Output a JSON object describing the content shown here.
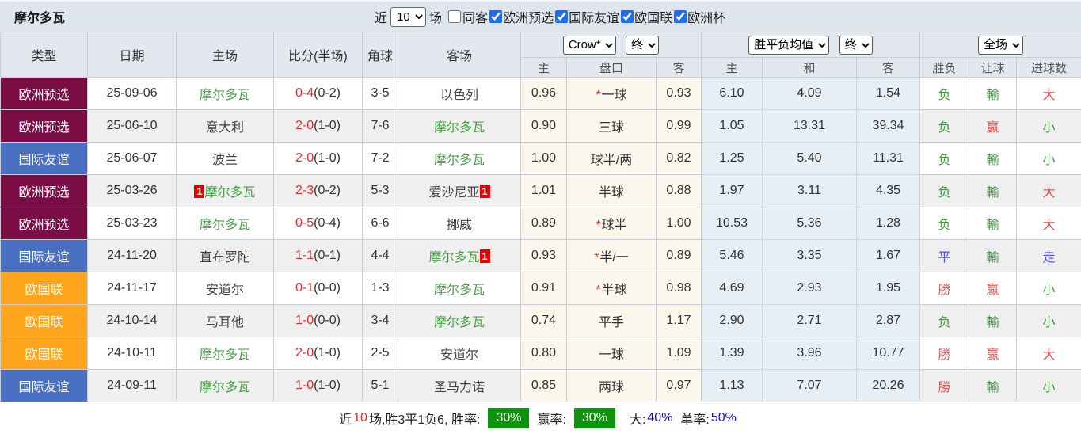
{
  "title": "摩尔多瓦",
  "toolbar": {
    "near_label": "近",
    "matches_selected": "10",
    "chang_label": "场",
    "tongke_label": "同客",
    "filters": [
      {
        "label": "欧洲预选",
        "checked": true
      },
      {
        "label": "国际友谊",
        "checked": true
      },
      {
        "label": "欧国联",
        "checked": true
      },
      {
        "label": "欧洲杯",
        "checked": true
      }
    ]
  },
  "table": {
    "col_headers": [
      "类型",
      "日期",
      "主场",
      "比分(半场)",
      "角球",
      "客场"
    ],
    "selects": {
      "company": "Crow*",
      "final1": "终",
      "avg": "胜平负均值",
      "final2": "终",
      "period": "全场"
    },
    "subheaders": [
      "主",
      "盘口",
      "客",
      "主",
      "和",
      "客",
      "胜负",
      "让球",
      "进球数"
    ],
    "rows": [
      {
        "type": "欧洲预选",
        "type_color": "maroon",
        "date": "25-09-06",
        "home": {
          "name": "摩尔多瓦",
          "green": true,
          "card": false
        },
        "score_full": "0-4",
        "score_half": "(0-2)",
        "corners": "3-5",
        "away": {
          "name": "以色列",
          "green": false,
          "card": false
        },
        "odds": {
          "home": "0.96",
          "line": "一球",
          "line_star": true,
          "away": "0.93"
        },
        "avg": {
          "win": "6.10",
          "draw": "4.09",
          "lose": "1.54"
        },
        "result": {
          "wl": {
            "text": "负",
            "color": "green"
          },
          "handicap": {
            "text": "輸",
            "color": "green"
          },
          "goals": {
            "text": "大",
            "color": "red"
          }
        }
      },
      {
        "type": "欧洲预选",
        "type_color": "maroon",
        "date": "25-06-10",
        "home": {
          "name": "意大利",
          "green": false,
          "card": false
        },
        "score_full": "2-0",
        "score_half": "(1-0)",
        "corners": "7-6",
        "away": {
          "name": "摩尔多瓦",
          "green": true,
          "card": false
        },
        "odds": {
          "home": "0.90",
          "line": "三球",
          "line_star": false,
          "away": "0.99"
        },
        "avg": {
          "win": "1.05",
          "draw": "13.31",
          "lose": "39.34"
        },
        "result": {
          "wl": {
            "text": "负",
            "color": "green"
          },
          "handicap": {
            "text": "赢",
            "color": "red"
          },
          "goals": {
            "text": "小",
            "color": "green"
          }
        }
      },
      {
        "type": "国际友谊",
        "type_color": "blue",
        "date": "25-06-07",
        "home": {
          "name": "波兰",
          "green": false,
          "card": false
        },
        "score_full": "2-0",
        "score_half": "(1-0)",
        "corners": "7-2",
        "away": {
          "name": "摩尔多瓦",
          "green": true,
          "card": false
        },
        "odds": {
          "home": "1.00",
          "line": "球半/两",
          "line_star": false,
          "away": "0.82"
        },
        "avg": {
          "win": "1.25",
          "draw": "5.40",
          "lose": "11.31"
        },
        "result": {
          "wl": {
            "text": "负",
            "color": "green"
          },
          "handicap": {
            "text": "輸",
            "color": "green"
          },
          "goals": {
            "text": "小",
            "color": "green"
          }
        }
      },
      {
        "type": "欧洲预选",
        "type_color": "maroon",
        "date": "25-03-26",
        "home": {
          "name": "摩尔多瓦",
          "green": true,
          "card": true
        },
        "score_full": "2-3",
        "score_half": "(0-2)",
        "corners": "5-3",
        "away": {
          "name": "爱沙尼亚",
          "green": false,
          "card": true
        },
        "odds": {
          "home": "1.01",
          "line": "半球",
          "line_star": false,
          "away": "0.88"
        },
        "avg": {
          "win": "1.97",
          "draw": "3.11",
          "lose": "4.35"
        },
        "result": {
          "wl": {
            "text": "负",
            "color": "green"
          },
          "handicap": {
            "text": "輸",
            "color": "green"
          },
          "goals": {
            "text": "大",
            "color": "red"
          }
        }
      },
      {
        "type": "欧洲预选",
        "type_color": "maroon",
        "date": "25-03-23",
        "home": {
          "name": "摩尔多瓦",
          "green": true,
          "card": false
        },
        "score_full": "0-5",
        "score_half": "(0-4)",
        "corners": "6-6",
        "away": {
          "name": "挪威",
          "green": false,
          "card": false
        },
        "odds": {
          "home": "0.89",
          "line": "球半",
          "line_star": true,
          "away": "1.00"
        },
        "avg": {
          "win": "10.53",
          "draw": "5.36",
          "lose": "1.28"
        },
        "result": {
          "wl": {
            "text": "负",
            "color": "green"
          },
          "handicap": {
            "text": "輸",
            "color": "green"
          },
          "goals": {
            "text": "大",
            "color": "red"
          }
        }
      },
      {
        "type": "国际友谊",
        "type_color": "blue",
        "date": "24-11-20",
        "home": {
          "name": "直布罗陀",
          "green": false,
          "card": false
        },
        "score_full": "1-1",
        "score_half": "(0-1)",
        "corners": "4-4",
        "away": {
          "name": "摩尔多瓦",
          "green": true,
          "card": true
        },
        "odds": {
          "home": "0.93",
          "line": "半/一",
          "line_star": true,
          "away": "0.89"
        },
        "avg": {
          "win": "5.46",
          "draw": "3.35",
          "lose": "1.67"
        },
        "result": {
          "wl": {
            "text": "平",
            "color": "blue"
          },
          "handicap": {
            "text": "輸",
            "color": "green"
          },
          "goals": {
            "text": "走",
            "color": "blue"
          }
        }
      },
      {
        "type": "欧国联",
        "type_color": "orange",
        "date": "24-11-17",
        "home": {
          "name": "安道尔",
          "green": false,
          "card": false
        },
        "score_full": "0-1",
        "score_half": "(0-0)",
        "corners": "1-3",
        "away": {
          "name": "摩尔多瓦",
          "green": true,
          "card": false
        },
        "odds": {
          "home": "0.91",
          "line": "半球",
          "line_star": true,
          "away": "0.98"
        },
        "avg": {
          "win": "4.69",
          "draw": "2.93",
          "lose": "1.95"
        },
        "result": {
          "wl": {
            "text": "勝",
            "color": "red"
          },
          "handicap": {
            "text": "赢",
            "color": "red"
          },
          "goals": {
            "text": "小",
            "color": "green"
          }
        }
      },
      {
        "type": "欧国联",
        "type_color": "orange",
        "date": "24-10-14",
        "home": {
          "name": "马耳他",
          "green": false,
          "card": false
        },
        "score_full": "1-0",
        "score_half": "(0-0)",
        "corners": "3-4",
        "away": {
          "name": "摩尔多瓦",
          "green": true,
          "card": false
        },
        "odds": {
          "home": "0.74",
          "line": "平手",
          "line_star": false,
          "away": "1.17"
        },
        "avg": {
          "win": "2.90",
          "draw": "2.71",
          "lose": "2.87"
        },
        "result": {
          "wl": {
            "text": "负",
            "color": "green"
          },
          "handicap": {
            "text": "輸",
            "color": "green"
          },
          "goals": {
            "text": "小",
            "color": "green"
          }
        }
      },
      {
        "type": "欧国联",
        "type_color": "orange",
        "date": "24-10-11",
        "home": {
          "name": "摩尔多瓦",
          "green": true,
          "card": false
        },
        "score_full": "2-0",
        "score_half": "(1-0)",
        "corners": "2-5",
        "away": {
          "name": "安道尔",
          "green": false,
          "card": false
        },
        "odds": {
          "home": "0.80",
          "line": "一球",
          "line_star": false,
          "away": "1.09"
        },
        "avg": {
          "win": "1.39",
          "draw": "3.96",
          "lose": "10.77"
        },
        "result": {
          "wl": {
            "text": "勝",
            "color": "red"
          },
          "handicap": {
            "text": "赢",
            "color": "red"
          },
          "goals": {
            "text": "大",
            "color": "red"
          }
        }
      },
      {
        "type": "国际友谊",
        "type_color": "blue",
        "date": "24-09-11",
        "home": {
          "name": "摩尔多瓦",
          "green": true,
          "card": false
        },
        "score_full": "1-0",
        "score_half": "(1-0)",
        "corners": "5-1",
        "away": {
          "name": "圣马力诺",
          "green": false,
          "card": false
        },
        "odds": {
          "home": "0.85",
          "line": "两球",
          "line_star": false,
          "away": "0.97"
        },
        "avg": {
          "win": "1.13",
          "draw": "7.07",
          "lose": "20.26"
        },
        "result": {
          "wl": {
            "text": "勝",
            "color": "red"
          },
          "handicap": {
            "text": "輸",
            "color": "green"
          },
          "goals": {
            "text": "小",
            "color": "green"
          }
        }
      }
    ]
  },
  "summary": {
    "near_label": "近",
    "count": "10",
    "stats_text": "场,胜3平1负6, 胜率:",
    "win_rate": "30%",
    "odds_rate_label": "赢率:",
    "odds_rate": "30%",
    "big_label": "大:",
    "big_rate": "40%",
    "single_label": "单率:",
    "single_rate": "50%"
  },
  "colors": {
    "type_maroon": "#7a0d45",
    "type_blue": "#4a71c1",
    "type_orange": "#ffa41c",
    "team_green": "#4aa04a",
    "score_red": "#e42e2e",
    "result_green": "#3f9b3f",
    "result_red": "#e05555",
    "result_blue": "#4e4ee0",
    "badge_green_bg": "#0e930e",
    "pct_blue": "#0b0bdc"
  }
}
